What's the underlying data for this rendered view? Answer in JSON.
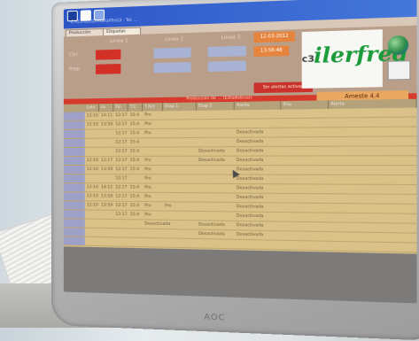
{
  "scene": {
    "monitor_brand": "AOC"
  },
  "app": {
    "window_title": "C:\\\\Ctrl\\\\1\\\\Lineas\\\\ATrs\\\\3 - Tel. ...",
    "tabs": [
      "Producción",
      "Etiquetas"
    ],
    "line_labels": [
      "Línea 1",
      "Línea 2",
      "Línea 3"
    ],
    "left_labels": [
      "Ctrl",
      "Prep"
    ],
    "date_box": "12-03-2012",
    "time_box": "13:56:48",
    "alert_box": "Sin alertas activas",
    "logo": "ilerfred",
    "logo_prefix": "c3",
    "section_bar": "Producción de ... (Estadisticas)",
    "status_box": "Ameste   4.4",
    "table": {
      "headers": [
        "Lote",
        "Ini",
        "Fin",
        "T.C",
        "T.Act",
        "Etap 1",
        "Etap 2",
        "Alerta",
        "Prio",
        "Alerta"
      ],
      "rows": [
        [
          "12:10",
          "14:11",
          "12:17",
          "15:4",
          "Pro",
          "",
          "",
          "",
          ""
        ],
        [
          "12:10",
          "13:59",
          "12:17",
          "15:4",
          "Pro",
          "",
          "",
          "",
          ""
        ],
        [
          "",
          "",
          "12:17",
          "15:4",
          "Pro",
          "",
          "",
          "Desactivada",
          ""
        ],
        [
          "",
          "",
          "12:17",
          "15:4",
          "",
          "",
          "",
          "Desactivada",
          ""
        ],
        [
          "",
          "",
          "12:17",
          "15:4",
          "",
          "",
          "Desactivada",
          "Desactivada",
          ""
        ],
        [
          "12:10",
          "12:17",
          "12:17",
          "15:4",
          "Pro",
          "",
          "Desactivada",
          "Desactivada",
          ""
        ],
        [
          "12:10",
          "13:59",
          "12:17",
          "15:4",
          "Pro",
          "",
          "",
          "Desactivada",
          ""
        ],
        [
          "",
          "",
          "12:17",
          "",
          "Pro",
          "",
          "",
          "Desactivada",
          ""
        ],
        [
          "12:10",
          "14:12",
          "12:17",
          "15:4",
          "Pro",
          "",
          "",
          "Desactivada",
          ""
        ],
        [
          "12:10",
          "13:59",
          "12:17",
          "15:4",
          "Pro",
          "",
          "",
          "Desactivada",
          ""
        ],
        [
          "12:10",
          "13:59",
          "12:17",
          "15:4",
          "Pro",
          "Pro",
          "",
          "Desactivada",
          ""
        ],
        [
          "",
          "",
          "12:17",
          "15:4",
          "Pro",
          "",
          "",
          "Desactivada",
          ""
        ],
        [
          "",
          "",
          "",
          "",
          "Desactivada",
          "",
          "Desactivada",
          "Desactivada",
          ""
        ],
        [
          "",
          "",
          "",
          "",
          "",
          "",
          "Desactivada",
          "Desactivada",
          ""
        ],
        [
          "",
          "",
          "",
          "",
          "",
          "",
          "",
          "",
          ""
        ]
      ]
    }
  }
}
